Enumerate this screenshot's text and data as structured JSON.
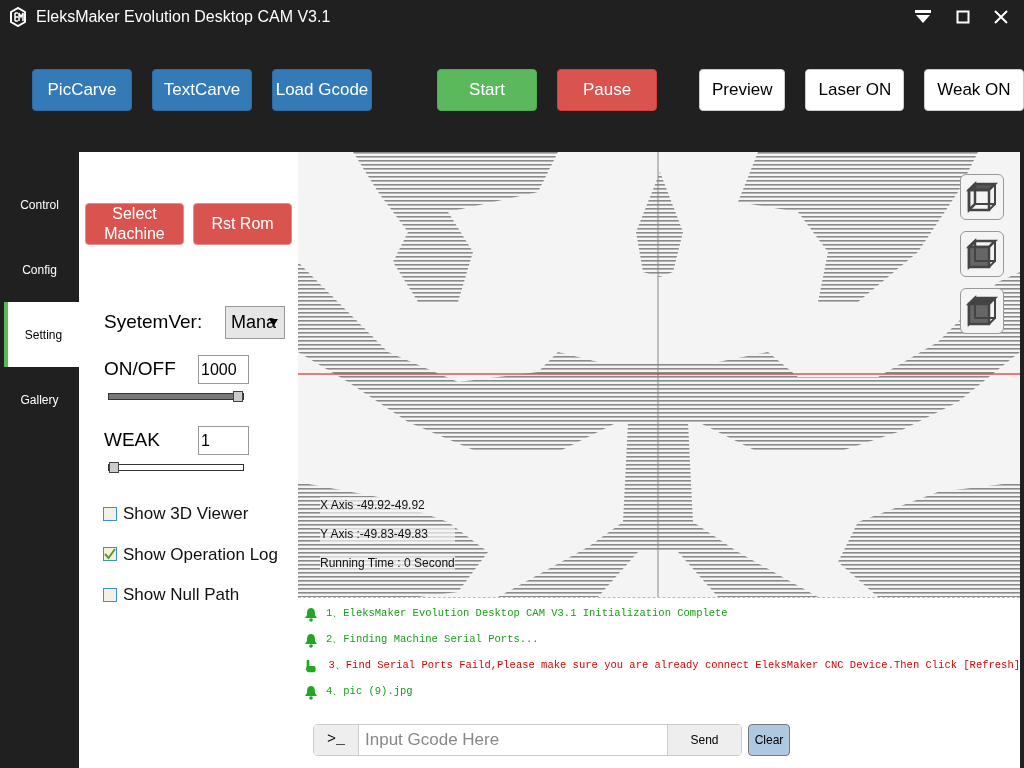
{
  "window": {
    "title": "EleksMaker Evolution Desktop CAM V3.1"
  },
  "toolbar": {
    "buttons": [
      {
        "label": "PicCarve",
        "kind": "blue"
      },
      {
        "label": "TextCarve",
        "kind": "blue"
      },
      {
        "label": "Load Gcode",
        "kind": "blue"
      },
      {
        "label": "Start",
        "kind": "green"
      },
      {
        "label": "Pause",
        "kind": "red"
      },
      {
        "label": "Preview",
        "kind": "white"
      },
      {
        "label": "Laser ON",
        "kind": "white"
      },
      {
        "label": "Weak ON",
        "kind": "white"
      }
    ]
  },
  "nav": {
    "tabs": [
      {
        "label": "Control",
        "selected": false
      },
      {
        "label": "Config",
        "selected": false
      },
      {
        "label": "Setting",
        "selected": true
      },
      {
        "label": "Gallery",
        "selected": false
      }
    ]
  },
  "settings": {
    "buttons": [
      "Select Machine",
      "Rst Rom"
    ],
    "system_ver": {
      "label": "SyetemVer:",
      "value": "Mana"
    },
    "sliders": [
      {
        "label": "ON/OFF",
        "value": "1000",
        "level": 1
      },
      {
        "label": "WEAK",
        "value": "1",
        "level": 0
      }
    ],
    "options": [
      {
        "label": "Show 3D Viewer",
        "checked": false
      },
      {
        "label": "Show Operation Log",
        "checked": true
      },
      {
        "label": "Show Null Path",
        "checked": false
      }
    ]
  },
  "canvas": {
    "readouts": [
      "X Axis -49.92-49.92",
      "Y Axis :-49.83-49.83",
      "Running Time : 0 Second"
    ]
  },
  "log": {
    "messages": [
      {
        "text": "1、EleksMaker Evolution Desktop CAM V3.1 Initialization Complete",
        "kind": "info"
      },
      {
        "text": "2、Finding Machine Serial Ports...",
        "kind": "info"
      },
      {
        "text": "3、Find Serial Ports Faild,Please make sure you are already connect EleksMaker CNC Device.Then Click [Refresh]",
        "kind": "error"
      },
      {
        "text": "4、pic (9).jpg",
        "kind": "info"
      }
    ]
  },
  "console": {
    "prompt": ">_",
    "placeholder": "Input Gcode Here",
    "send": "Send",
    "clear": "Clear"
  }
}
